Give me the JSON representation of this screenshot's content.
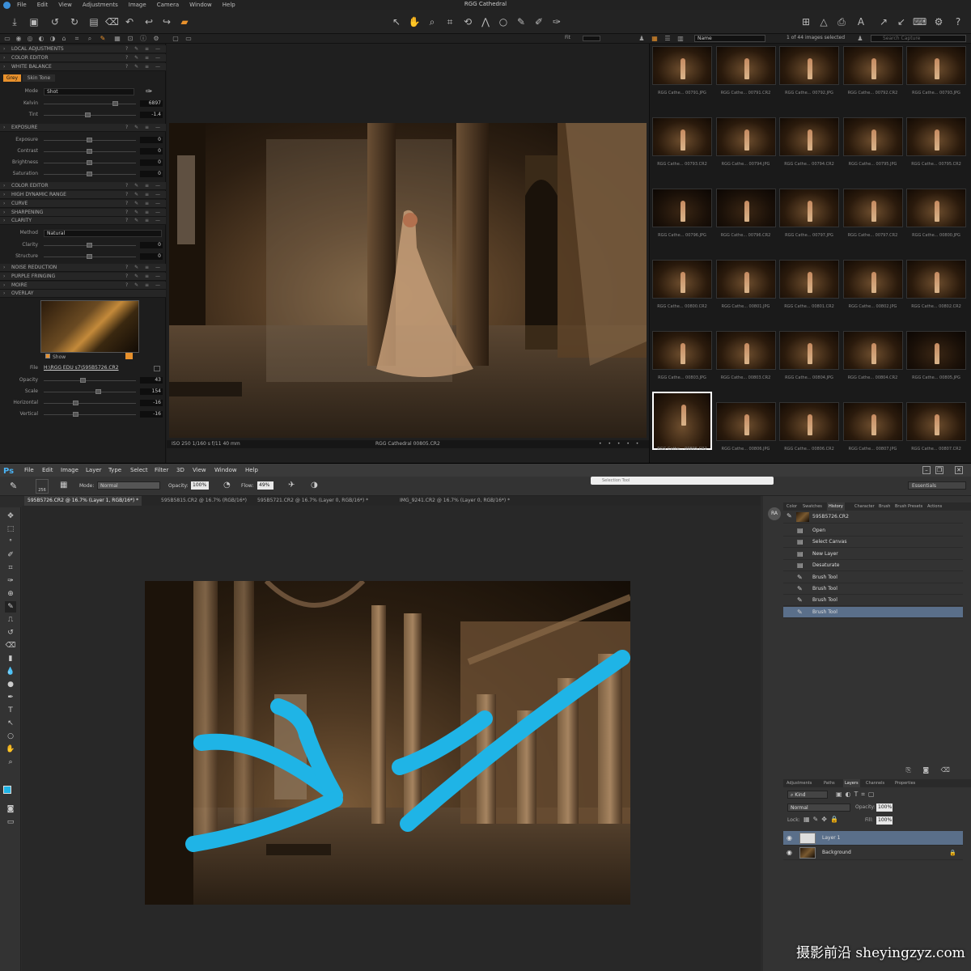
{
  "capture_one": {
    "menu": [
      "File",
      "Edit",
      "View",
      "Adjustments",
      "Image",
      "Camera",
      "Window",
      "Help"
    ],
    "title": "RGG Cathedral",
    "browser_header": {
      "fit": "Fit",
      "sort": "Name",
      "selection": "1 of 44 images selected",
      "search_placeholder": "Search Capture"
    },
    "sections": {
      "local_adjustments": "LOCAL ADJUSTMENTS",
      "color_editor": "COLOR EDITOR",
      "white_balance": "WHITE BALANCE",
      "exposure": "EXPOSURE",
      "color_editor2": "COLOR EDITOR",
      "hdr": "HIGH DYNAMIC RANGE",
      "curve": "CURVE",
      "sharpening": "SHARPENING",
      "clarity": "CLARITY",
      "noise": "NOISE REDUCTION",
      "purple": "PURPLE FRINGING",
      "moire": "MOIRE",
      "overlay": "OVERLAY"
    },
    "white_balance": {
      "tab_grey": "Grey",
      "tab_skin": "Skin Tone",
      "mode_label": "Mode",
      "mode_value": "Shot",
      "kelvin_label": "Kelvin",
      "kelvin_value": "6897",
      "kelvin_level": 0.78,
      "tint_label": "Tint",
      "tint_value": "-1.4",
      "tint_level": 0.48
    },
    "exposure": {
      "rows": [
        {
          "label": "Exposure",
          "value": "0"
        },
        {
          "label": "Contrast",
          "value": "0"
        },
        {
          "label": "Brightness",
          "value": "0"
        },
        {
          "label": "Saturation",
          "value": "0"
        }
      ]
    },
    "clarity": {
      "method_label": "Method",
      "method_value": "Natural",
      "clarity_label": "Clarity",
      "clarity_value": "0",
      "structure_label": "Structure",
      "structure_value": "0"
    },
    "overlay": {
      "show_label": "Show",
      "file_label": "File",
      "file_value": "H:\\RGG EDU s7\\595B5726.CR2",
      "rows": [
        {
          "label": "Opacity",
          "value": "43",
          "level": 0.43
        },
        {
          "label": "Scale",
          "value": "154",
          "level": 0.6
        },
        {
          "label": "Horizontal",
          "value": "-16",
          "level": 0.35
        },
        {
          "label": "Vertical",
          "value": "-16",
          "level": 0.35
        }
      ]
    },
    "viewer_status": {
      "exif": "ISO 250 1/160 s f/11 40 mm",
      "filename": "RGG Cathedral 00805.CR2"
    },
    "thumbnails": [
      "RGG Cathe... 00791.JPG",
      "RGG Cathe... 00791.CR2",
      "RGG Cathe... 00792.JPG",
      "RGG Cathe... 00792.CR2",
      "RGG Cathe... 00793.JPG",
      "RGG Cathe... 00793.CR2",
      "RGG Cathe... 00794.JPG",
      "RGG Cathe... 00794.CR2",
      "RGG Cathe... 00795.JPG",
      "RGG Cathe... 00795.CR2",
      "RGG Cathe... 00796.JPG",
      "RGG Cathe... 00796.CR2",
      "RGG Cathe... 00797.JPG",
      "RGG Cathe... 00797.CR2",
      "RGG Cathe... 00800.JPG",
      "RGG Cathe... 00800.CR2",
      "RGG Cathe... 00801.JPG",
      "RGG Cathe... 00801.CR2",
      "RGG Cathe... 00802.JPG",
      "RGG Cathe... 00802.CR2",
      "RGG Cathe... 00803.JPG",
      "RGG Cathe... 00803.CR2",
      "RGG Cathe... 00804.JPG",
      "RGG Cathe... 00804.CR2",
      "RGG Cathe... 00805.JPG",
      "RGG Cathe... 00805.CR2",
      "RGG Cathe... 00806.JPG",
      "RGG Cathe... 00806.CR2",
      "RGG Cathe... 00807.JPG",
      "RGG Cathe... 00807.CR2"
    ]
  },
  "photoshop": {
    "logo": "Ps",
    "menu": [
      "File",
      "Edit",
      "Image",
      "Layer",
      "Type",
      "Select",
      "Filter",
      "3D",
      "View",
      "Window",
      "Help"
    ],
    "options": {
      "brush_size": "256",
      "mode_label": "Mode:",
      "mode_value": "Normal",
      "opacity_label": "Opacity:",
      "opacity_value": "100%",
      "flow_label": "Flow:",
      "flow_value": "49%",
      "workspace": "Essentials"
    },
    "search_placeholder": "Selection Tool",
    "doc_tabs": [
      "595B5726.CR2 @ 16.7% (Layer 1, RGB/16*) *",
      "595B5815.CR2 @ 16.7% (RGB/16*)",
      "595B5721.CR2 @ 16.7% (Layer 0, RGB/16*) *",
      "IMG_9241.CR2 @ 16.7% (Layer 0, RGB/16*) *"
    ],
    "panel_tabs_top": [
      "Color",
      "Swatches",
      "History",
      "Character",
      "Brush",
      "Brush Presets",
      "Actions"
    ],
    "history": {
      "snapshot": "595B5726.CR2",
      "items": [
        "Open",
        "Select Canvas",
        "New Layer",
        "Desaturate",
        "Brush Tool",
        "Brush Tool",
        "Brush Tool",
        "Brush Tool"
      ]
    },
    "panel_tabs_bottom": [
      "Adjustments",
      "Paths",
      "Layers",
      "Channels",
      "Properties"
    ],
    "layers": {
      "kind": "Kind",
      "blend": "Normal",
      "opacity_label": "Opacity:",
      "opacity_value": "100%",
      "lock_label": "Lock:",
      "fill_label": "Fill:",
      "fill_value": "100%",
      "items": [
        "Layer 1",
        "Background"
      ]
    },
    "brush_color": "#1fb4e6"
  },
  "watermark": "摄影前沿 sheyingzyz.com"
}
